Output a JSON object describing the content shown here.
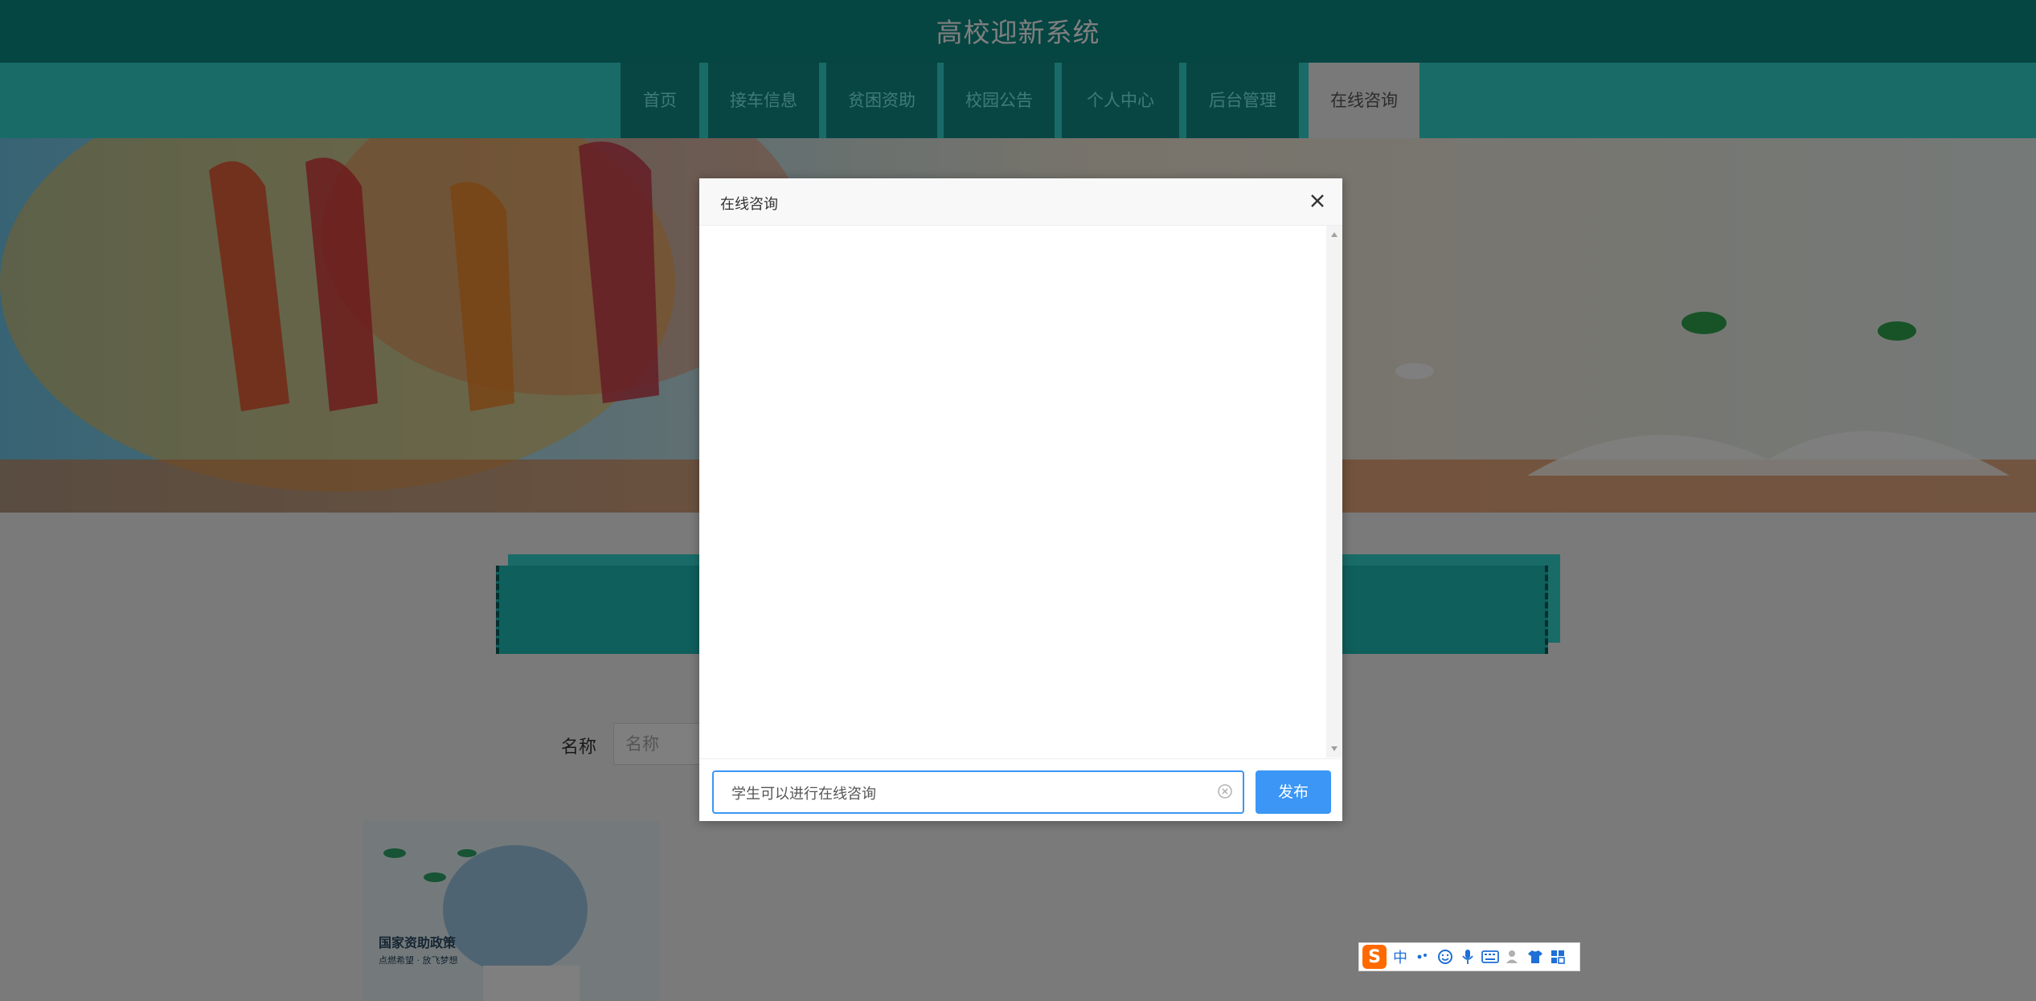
{
  "header": {
    "title": "高校迎新系统"
  },
  "nav": {
    "items": [
      {
        "label": "首页"
      },
      {
        "label": "接车信息"
      },
      {
        "label": "贫困资助"
      },
      {
        "label": "校园公告"
      },
      {
        "label": "个人中心"
      },
      {
        "label": "后台管理"
      },
      {
        "label": "在线咨询"
      }
    ],
    "active_index": 6
  },
  "filter": {
    "label": "名称",
    "placeholder": "名称"
  },
  "card": {
    "title": "国家资助政策",
    "subtitle": "点燃希望 · 放飞梦想"
  },
  "modal": {
    "title": "在线咨询",
    "input_value": "学生可以进行在线咨询",
    "send_label": "发布"
  },
  "ime": {
    "mode_label": "中"
  },
  "colors": {
    "header_bg": "#0b8a85",
    "nav_bg": "#33d6d0",
    "nav_item_bg": "#108d88",
    "primary_button": "#3b96f5"
  }
}
